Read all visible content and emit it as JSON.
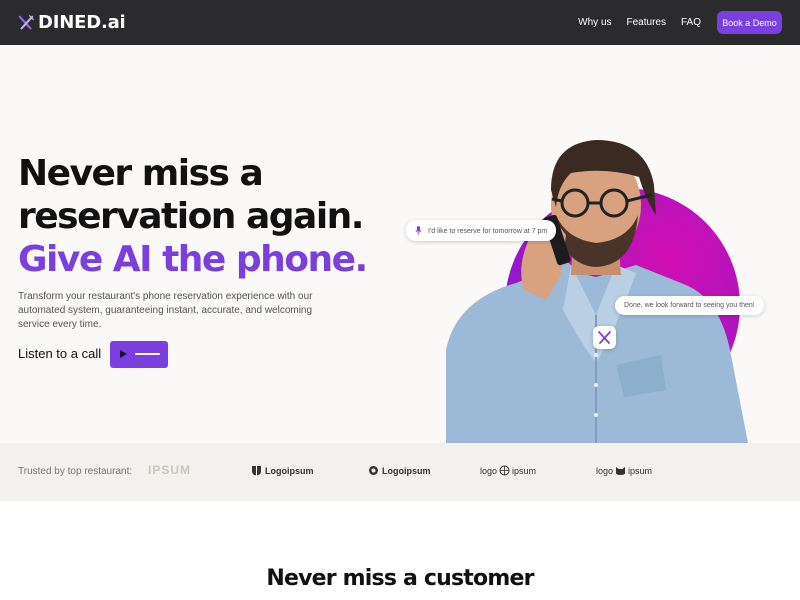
{
  "brand": {
    "name": "DINED.ai"
  },
  "nav": {
    "links": [
      "Why us",
      "Features",
      "FAQ"
    ],
    "cta": "Book a Demo"
  },
  "hero": {
    "line1": "Never miss a",
    "line2": "reservation again.",
    "line3": "Give AI the phone.",
    "description": "Transform your restaurant's phone reservation experience with our automated system, guaranteeing instant, accurate, and welcoming service every time.",
    "listen_label": "Listen to a call",
    "bubble_caller": "I'd like to reserve for tomorrow at 7 pm",
    "bubble_ai": "Done, we look forward to seeing you then!"
  },
  "trusted": {
    "label": "Trusted by top restaurant:",
    "logos": [
      "IPSUM",
      "Logoipsum",
      "Logoipsum",
      "logo",
      "ipsum",
      "logo",
      "ipsum"
    ]
  },
  "section": {
    "title": "Never miss a customer"
  },
  "colors": {
    "accent": "#7b3fe0",
    "nav_bg": "#2b2b2d",
    "hero_bg": "#faf9f8",
    "trust_bg": "#f3f1ed"
  },
  "icons": [
    "fork-knife-icon",
    "mic-icon",
    "play-icon"
  ]
}
